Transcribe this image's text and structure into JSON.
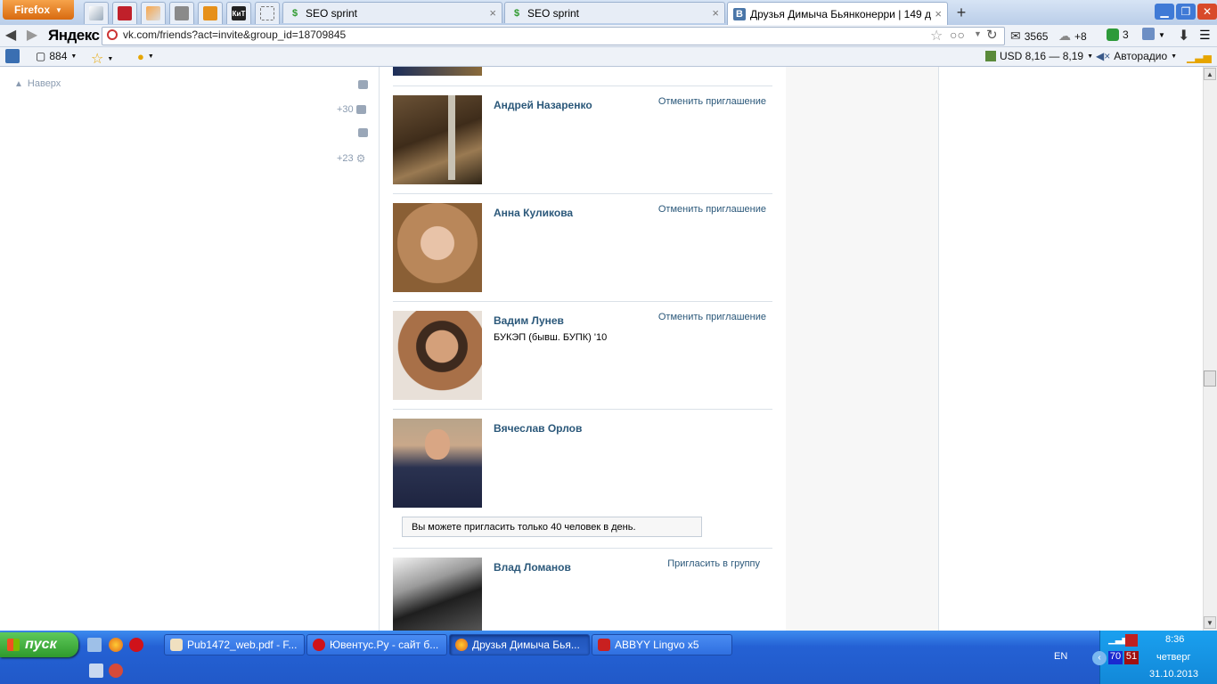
{
  "browser": {
    "menu_button": "Firefox",
    "tabs": [
      {
        "label": "SEO sprint",
        "close": "×"
      },
      {
        "label": "SEO sprint",
        "close": "×"
      },
      {
        "label": "Друзья Димыча Бьянконерри | 149 др...",
        "close": "×"
      }
    ],
    "new_tab": "+",
    "app_tab_label": "КиТ",
    "window_buttons": {
      "minimize": "▁",
      "restore": "❐",
      "close": "✕"
    },
    "yandex_logo": "Яндекс",
    "url": "vk.com/friends?act=invite&group_id=18709845",
    "mail_count": "3565",
    "weather": "+8",
    "notify_count": "3",
    "bookmarks_count": "884",
    "currency": "USD 8,16 — 8,19",
    "radio": "Авторадио"
  },
  "page": {
    "back_to_top": "Наверх",
    "side_counts": {
      "friends": "+30",
      "settings": "+23"
    },
    "friends": [
      {
        "name": "Андрей Назаренко",
        "subtitle": "",
        "action": "Отменить приглашение"
      },
      {
        "name": "Анна Куликова",
        "subtitle": "",
        "action": "Отменить приглашение"
      },
      {
        "name": "Вадим Лунев",
        "subtitle": "БУКЭП (бывш. БУПК) '10",
        "action": "Отменить приглашение"
      },
      {
        "name": "Вячеслав Орлов",
        "subtitle": "",
        "action": ""
      },
      {
        "name": "Влад Ломанов",
        "subtitle": "",
        "action": "Пригласить в группу"
      }
    ],
    "limit_notice": "Вы можете пригласить только 40 человек в день."
  },
  "taskbar": {
    "start": "пуск",
    "buttons": [
      {
        "label": "Pub1472_web.pdf - F..."
      },
      {
        "label": "Ювентус.Ру - сайт б..."
      },
      {
        "label": "Друзья Димыча Бья..."
      },
      {
        "label": "ABBYY Lingvo x5"
      }
    ],
    "lang": "EN",
    "temps": [
      "70",
      "51"
    ],
    "time": "8:36",
    "weekday": "четверг",
    "date": "31.10.2013"
  },
  "colors": {
    "vk_link": "#2b587a",
    "taskbar": "#2459c8",
    "start": "#3aa336"
  }
}
